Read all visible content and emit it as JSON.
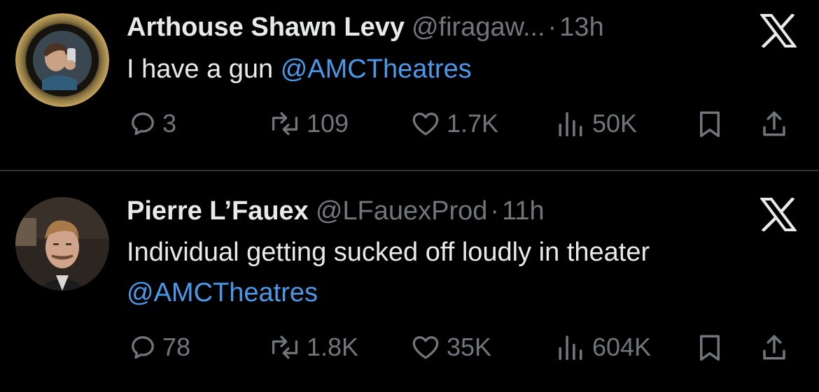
{
  "tweets": [
    {
      "display_name": "Arthouse Shawn Levy",
      "handle": "@firagaw...",
      "separator": "·",
      "time": "13h",
      "text": "I have a gun",
      "mention": "@AMCTheatres",
      "replies": "3",
      "retweets": "109",
      "likes": "1.7K",
      "views": "50K"
    },
    {
      "display_name": "Pierre L’Fauex",
      "handle": "@LFauexProd",
      "separator": "·",
      "time": "11h",
      "text": "Individual getting sucked off loudly in theater",
      "mention": "@AMCTheatres",
      "replies": "78",
      "retweets": "1.8K",
      "likes": "35K",
      "views": "604K"
    }
  ],
  "icons": {
    "logo": "x-logo-icon",
    "reply": "reply-icon",
    "retweet": "retweet-icon",
    "like": "heart-icon",
    "views": "views-icon",
    "bookmark": "bookmark-icon",
    "share": "share-icon"
  },
  "colors": {
    "background": "#000000",
    "primary_text": "#e7e9ea",
    "secondary_text": "#71767b",
    "link": "#4a99e9",
    "divider": "#2f3336"
  }
}
